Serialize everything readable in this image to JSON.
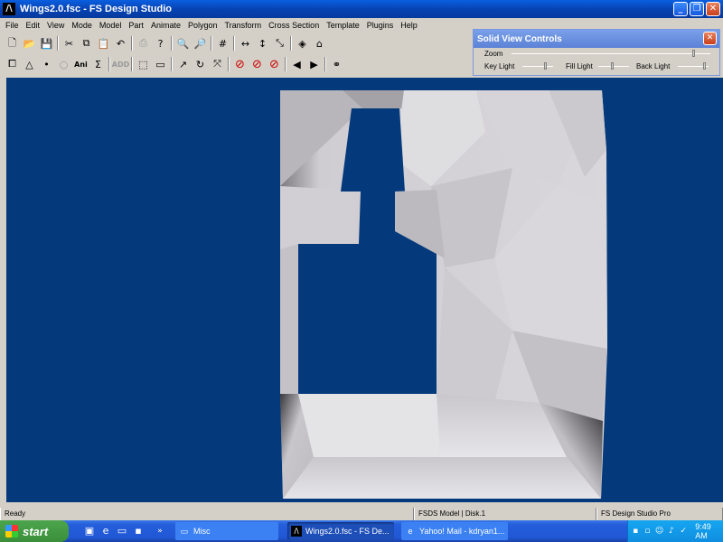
{
  "window": {
    "title": "Wings2.0.fsc - FS Design Studio",
    "app_icon": "fsds-logo-icon"
  },
  "menu": [
    "File",
    "Edit",
    "View",
    "Mode",
    "Model",
    "Part",
    "Animate",
    "Polygon",
    "Transform",
    "Cross Section",
    "Template",
    "Plugins",
    "Help"
  ],
  "toolbar_labels": {
    "ani": "Ani",
    "sum": "Σ",
    "add": "ADD"
  },
  "panel": {
    "title": "Solid View Controls",
    "zoom_label": "Zoom",
    "key_light_label": "Key Light",
    "fill_light_label": "Fill Light",
    "back_light_label": "Back Light",
    "zoom": 0.95,
    "key_light": 0.8,
    "fill_light": 0.5,
    "back_light": 0.85
  },
  "status": {
    "left": "Ready",
    "middle": "FSDS Model | Disk.1",
    "right": "FS Design Studio Pro"
  },
  "taskbar": {
    "start_label": "start",
    "tasks": [
      {
        "label": "Misc",
        "icon": "folder-icon"
      },
      {
        "label": "Wings2.0.fsc - FS De...",
        "icon": "fsds-icon"
      },
      {
        "label": "Yahoo! Mail - kdryan1...",
        "icon": "ie-icon"
      }
    ],
    "clock": "9:49 AM"
  },
  "colors": {
    "viewport": "#043a7c",
    "model": "#d8d6da",
    "titlebar": "#0743b4"
  }
}
